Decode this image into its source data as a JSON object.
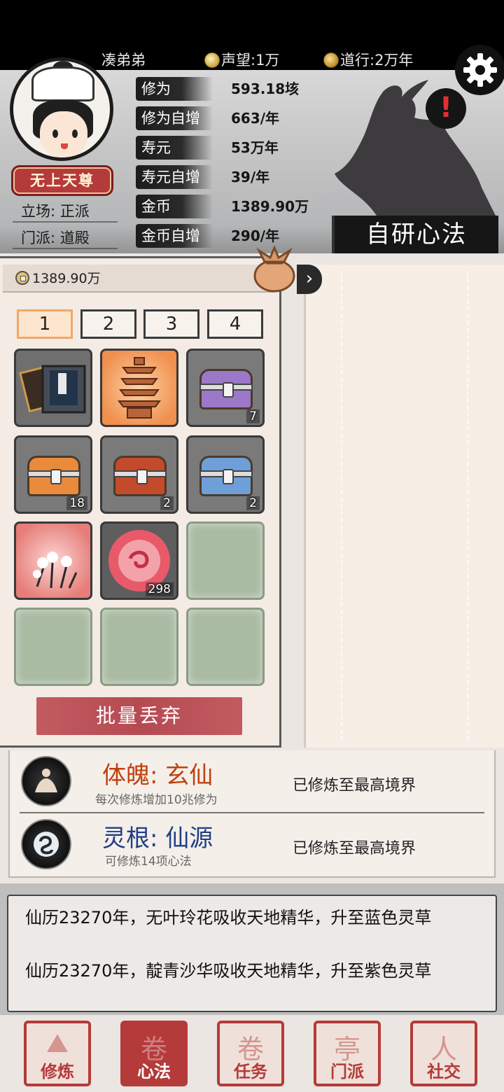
{
  "top": {
    "player_name": "凑弟弟",
    "reputation": "声望:1万",
    "daoxing": "道行:2万年"
  },
  "profile": {
    "title_badge": "无上天尊",
    "stance": "立场: 正派",
    "sect": "门派: 道殿"
  },
  "stats": [
    {
      "label": "修为",
      "value": "593.18垓"
    },
    {
      "label": "修为自增",
      "value": "663/年"
    },
    {
      "label": "寿元",
      "value": "53万年"
    },
    {
      "label": "寿元自增",
      "value": "39/年"
    },
    {
      "label": "金币",
      "value": "1389.90万"
    },
    {
      "label": "金币自增",
      "value": "290/年"
    }
  ],
  "research_button": "自研心法",
  "inventory": {
    "coins": "1389.90万",
    "tabs": [
      "1",
      "2",
      "3",
      "4"
    ],
    "active_tab": "1",
    "items": [
      {
        "icon": "manual-book-icon",
        "count": ""
      },
      {
        "icon": "pagoda-icon",
        "count": ""
      },
      {
        "icon": "purple-chest-icon",
        "count": "7"
      },
      {
        "icon": "orange-chest-icon",
        "count": "18"
      },
      {
        "icon": "red-gold-chest-icon",
        "count": "2"
      },
      {
        "icon": "blue-chest-icon",
        "count": "2"
      },
      {
        "icon": "white-flower-herb-icon",
        "count": ""
      },
      {
        "icon": "red-swirl-orb-icon",
        "count": "298"
      }
    ],
    "discard_button": "批量丢弃"
  },
  "cultivation": [
    {
      "title": "体魄: 玄仙",
      "subtitle": "每次修炼增加10兆修为",
      "status": "已修炼至最高境界",
      "title_color": "#c0410e"
    },
    {
      "title": "灵根: 仙源",
      "subtitle": "可修炼14项心法",
      "status": "已修炼至最高境界",
      "title_color": "#1f3f86"
    }
  ],
  "log": {
    "lines": [
      "仙历23270年，无叶玲花吸收天地精华，升至蓝色灵草",
      "仙历23270年，靛青沙华吸收天地精华，升至紫色灵草"
    ]
  },
  "nav": {
    "items": [
      {
        "label": "修炼",
        "glyph": "⛰"
      },
      {
        "label": "心法",
        "glyph": "卷"
      },
      {
        "label": "任务",
        "glyph": "卷"
      },
      {
        "label": "门派",
        "glyph": "亭"
      },
      {
        "label": "社交",
        "glyph": "人"
      }
    ],
    "active": "心法"
  },
  "colors": {
    "accent_red": "#b53a3a",
    "active_tab": "#f2a866",
    "discard": "#bc5058"
  }
}
